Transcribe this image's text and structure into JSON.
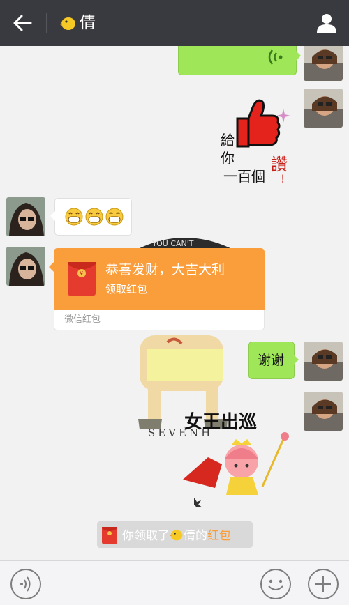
{
  "header": {
    "back_icon": "arrow-left-icon",
    "title": "倩",
    "title_emoji": "chick-emoji",
    "profile_icon": "person-icon"
  },
  "messages": [
    {
      "from": "me",
      "type": "voice",
      "icon": "voice-wave-icon"
    },
    {
      "from": "me",
      "type": "sticker",
      "sticker_name": "thumbs-up-sticker",
      "text_lines": [
        "給",
        "你",
        "一百個",
        "讚"
      ],
      "mark": "!"
    },
    {
      "from": "other",
      "type": "emoji",
      "emojis": [
        "grin-emoji",
        "grin-emoji",
        "grin-emoji"
      ]
    },
    {
      "from": "other",
      "type": "red-packet",
      "title": "恭喜发财，大吉大利",
      "subtitle": "领取红包",
      "brand": "微信红包"
    },
    {
      "from": "me",
      "type": "text",
      "text": "谢谢"
    },
    {
      "from": "me",
      "type": "sticker",
      "sticker_name": "queen-patrol-sticker",
      "caption": "女王出巡"
    }
  ],
  "background_sticker": {
    "cap_text": "YOU CAN'T",
    "label": "SEVENH"
  },
  "system_note": {
    "prefix": "你领取了",
    "name": "倩",
    "suffix": "的",
    "link": "红包"
  },
  "colors": {
    "topbar": "#393a3f",
    "bubble_green": "#9fe658",
    "red_packet": "#fa9d3b",
    "packet_red": "#e53b2f"
  },
  "footer": {
    "voice_icon": "voice-mode-icon",
    "emoji_icon": "emoji-face-icon",
    "plus_icon": "plus-icon",
    "input_value": ""
  }
}
